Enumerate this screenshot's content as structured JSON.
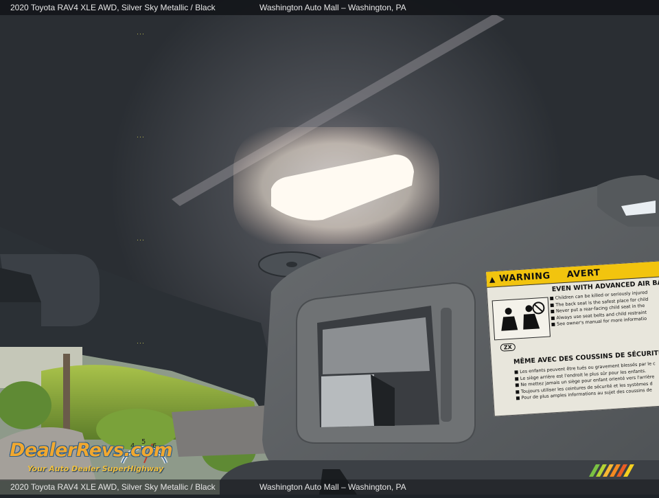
{
  "caption": {
    "vehicle": "2020 Toyota RAV4 XLE AWD,  Silver Sky Metallic / Black",
    "dealer": "Washington Auto Mall – Washington, PA"
  },
  "watermark": {
    "logo_text": "DealerRevs.com",
    "tagline": "Your Auto Dealer SuperHighway",
    "gauge_digits": [
      "4",
      "5",
      "6"
    ]
  },
  "warning_label": {
    "header_left": "WARNING",
    "header_right": "AVERT",
    "title_en": "EVEN WITH ADVANCED AIR BA",
    "lines_en": [
      "Children can be killed or seriously injured",
      "The back seat is the safest place for child",
      "Never put a rear-facing child seat in the",
      "Always use seat belts and child restraint",
      "See owner's manual for more informatio"
    ],
    "code": "ZX",
    "title_fr": "MÊME AVEC DES COUSSINS DE SÉCURITÉ",
    "lines_fr": [
      "Les enfants peuvent être tués ou gravement blessés par le c",
      "Le siège arrière est l'endroit le plus sûr pour les enfants.",
      "Ne mettez jamais un siège pour enfant orienté vers l'arrière",
      "Toujours utiliser les ceintures de sécurité et les systèmes d",
      "Pour de plus amples informations au sujet des coussins de"
    ]
  },
  "colors": {
    "headliner": "#3a3f45",
    "visor": "#5b5f62",
    "dome_light": "#fff6ea",
    "warning_yellow": "#f2c40e",
    "logo_orange": "#f0a830",
    "logo_blue": "#2c5d8a"
  }
}
